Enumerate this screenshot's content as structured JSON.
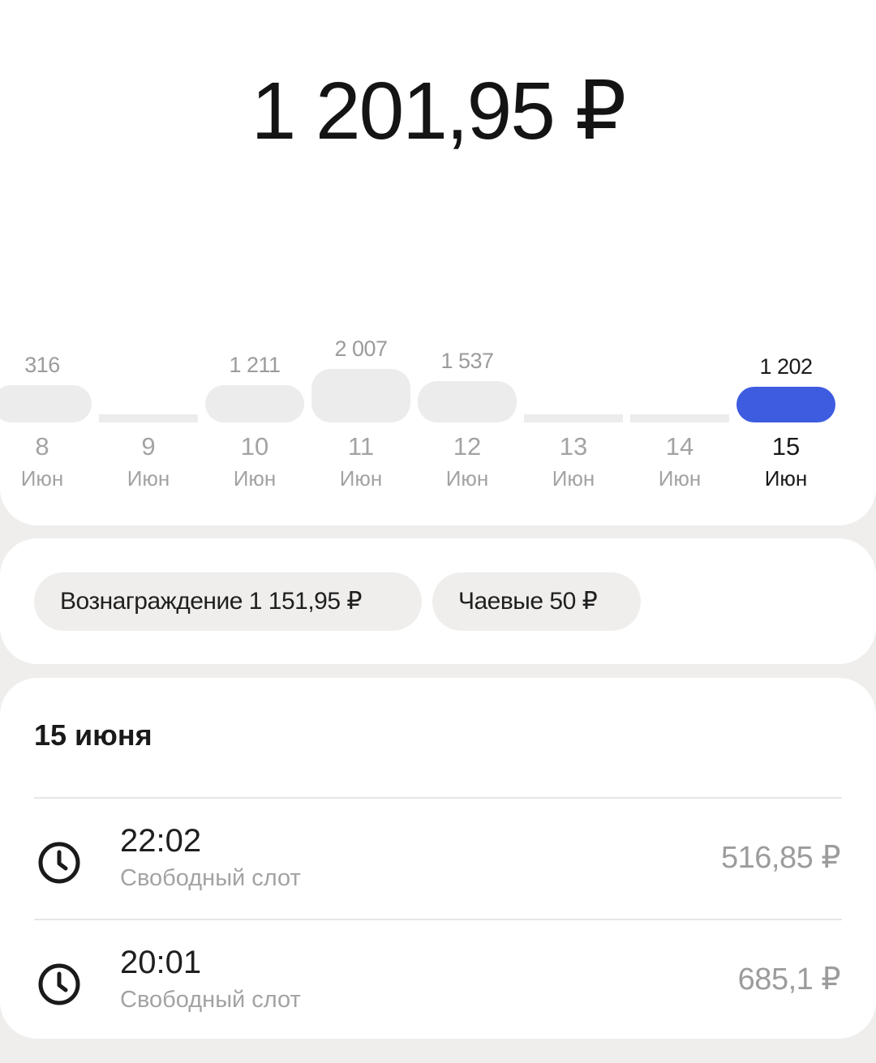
{
  "summary": {
    "total": "1 201,95 ₽"
  },
  "days": [
    {
      "amount": "316",
      "day": "8",
      "month": "Июн",
      "value": 316
    },
    {
      "amount": "",
      "day": "9",
      "month": "Июн",
      "value": 0
    },
    {
      "amount": "1 211",
      "day": "10",
      "month": "Июн",
      "value": 1211
    },
    {
      "amount": "2 007",
      "day": "11",
      "month": "Июн",
      "value": 2007
    },
    {
      "amount": "1 537",
      "day": "12",
      "month": "Июн",
      "value": 1537
    },
    {
      "amount": "",
      "day": "13",
      "month": "Июн",
      "value": 0
    },
    {
      "amount": "",
      "day": "14",
      "month": "Июн",
      "value": 0
    },
    {
      "amount": "1 202",
      "day": "15",
      "month": "Июн",
      "value": 1202,
      "selected": true
    }
  ],
  "chips": {
    "reward": "Вознаграждение 1 151,95 ₽",
    "tips": "Чаевые 50 ₽"
  },
  "list": {
    "date": "15 июня",
    "items": [
      {
        "time": "22:02",
        "subtitle": "Свободный слот",
        "amount": "516,85 ₽",
        "icon": "clock-icon"
      },
      {
        "time": "20:01",
        "subtitle": "Свободный слот",
        "amount": "685,1 ₽",
        "icon": "clock-icon"
      }
    ]
  },
  "colors": {
    "accent": "#3d5ce0",
    "background": "#efeeec",
    "card": "#ffffff"
  }
}
